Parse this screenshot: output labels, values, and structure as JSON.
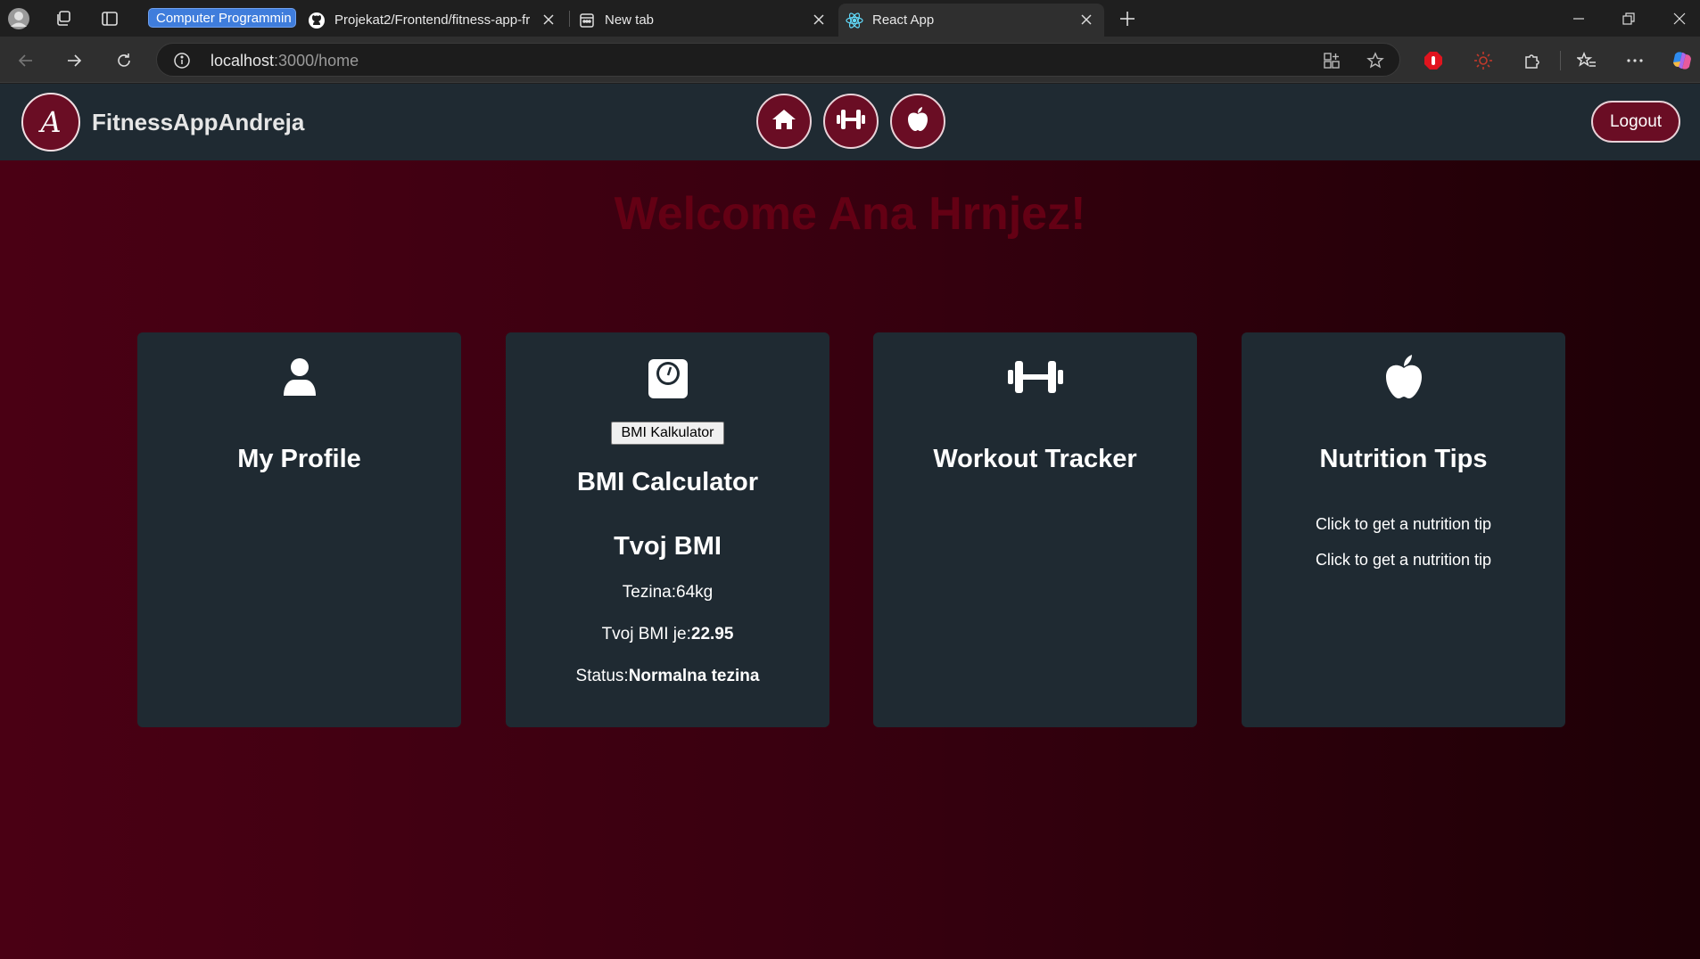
{
  "browser": {
    "tab_group_label": "Computer Programmin",
    "tabs": [
      {
        "label": "Projekat2/Frontend/fitness-app-fr",
        "icon": "github-icon"
      },
      {
        "label": "New tab",
        "icon": "new-tab-icon"
      },
      {
        "label": "React App",
        "icon": "react-icon",
        "active": true
      }
    ],
    "url_host": "localhost",
    "url_path": ":3000/home"
  },
  "app": {
    "logo_letter": "A",
    "brand": "FitnessAppAndreja",
    "nav_icons": [
      "home-icon",
      "dumbbell-icon",
      "apple-icon"
    ],
    "logout_label": "Logout",
    "welcome": "Welcome Ana Hrnjez!",
    "cards": {
      "profile": {
        "title": "My Profile",
        "icon": "user-icon"
      },
      "bmi": {
        "icon": "scale-icon",
        "button_label": "BMI Kalkulator",
        "title": "BMI Calculator",
        "subtitle": "Tvoj BMI",
        "weight_label": "Tezina:",
        "weight_value": "64kg",
        "bmi_label": "Tvoj BMI je:",
        "bmi_value": "22.95",
        "status_label": "Status:",
        "status_value": "Normalna tezina"
      },
      "workout": {
        "title": "Workout Tracker",
        "icon": "dumbbell-icon"
      },
      "nutrition": {
        "title": "Nutrition Tips",
        "icon": "apple-icon",
        "tips": [
          "Click to get a nutrition tip",
          "Click to get a nutrition tip"
        ]
      }
    }
  },
  "colors": {
    "nav_bg": "#1f2a32",
    "accent": "#6a0d24",
    "welcome_text": "#640014",
    "background_gradient_start": "#4a0014",
    "background_gradient_end": "#1e0006"
  }
}
